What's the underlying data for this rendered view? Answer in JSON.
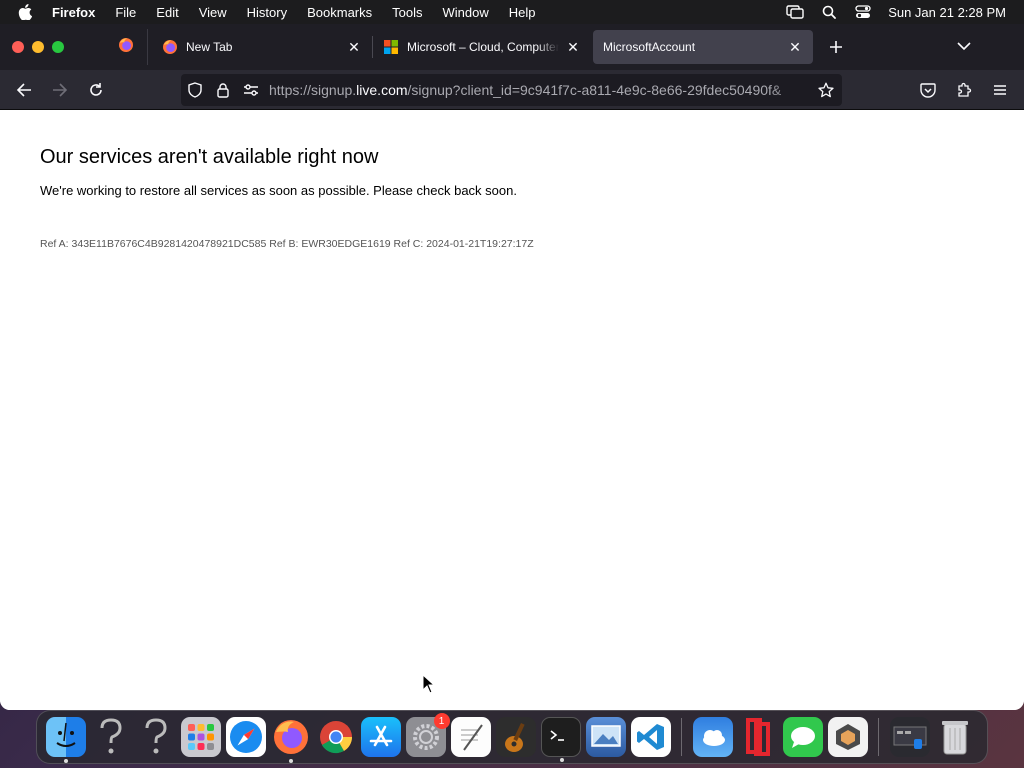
{
  "menubar": {
    "app_name": "Firefox",
    "items": [
      "File",
      "Edit",
      "View",
      "History",
      "Bookmarks",
      "Tools",
      "Window",
      "Help"
    ],
    "clock": "Sun Jan 21  2:28 PM"
  },
  "tabs": [
    {
      "title": "New Tab",
      "icon": "firefox-icon",
      "active": false
    },
    {
      "title": "Microsoft – Cloud, Computers, Apps & Gaming",
      "icon": "microsoft-icon",
      "active": false
    },
    {
      "title": "MicrosoftAccount",
      "icon": "none",
      "active": true
    }
  ],
  "urlbar": {
    "url_prefix": "https://signup.",
    "url_domain": "live.com",
    "url_rest": "/signup?client_id=9c941f7c-a811-4e9c-8e66-29fdec50490f&"
  },
  "page": {
    "heading": "Our services aren't available right now",
    "message": "We're working to restore all services as soon as possible. Please check back soon.",
    "reference": "Ref A: 343E11B7676C4B9281420478921DC585 Ref B: EWR30EDGE1619 Ref C: 2024-01-21T19:27:17Z"
  },
  "dock": {
    "apps": [
      "Finder",
      "Unknown",
      "Unknown",
      "Launchpad",
      "Safari",
      "Firefox",
      "Chrome",
      "App Store",
      "System Settings",
      "TextEdit",
      "GarageBand",
      "Terminal",
      "Preview",
      "VS Code",
      "Weather",
      "Parallels",
      "Messages",
      "Cursor",
      "Window Manager",
      "Trash"
    ],
    "settings_badge": "1"
  },
  "colors": {
    "tabbar": "#1f1e25",
    "navbar": "#2b2a33",
    "active_tab": "#42414d",
    "urlbar": "#1c1b22"
  }
}
